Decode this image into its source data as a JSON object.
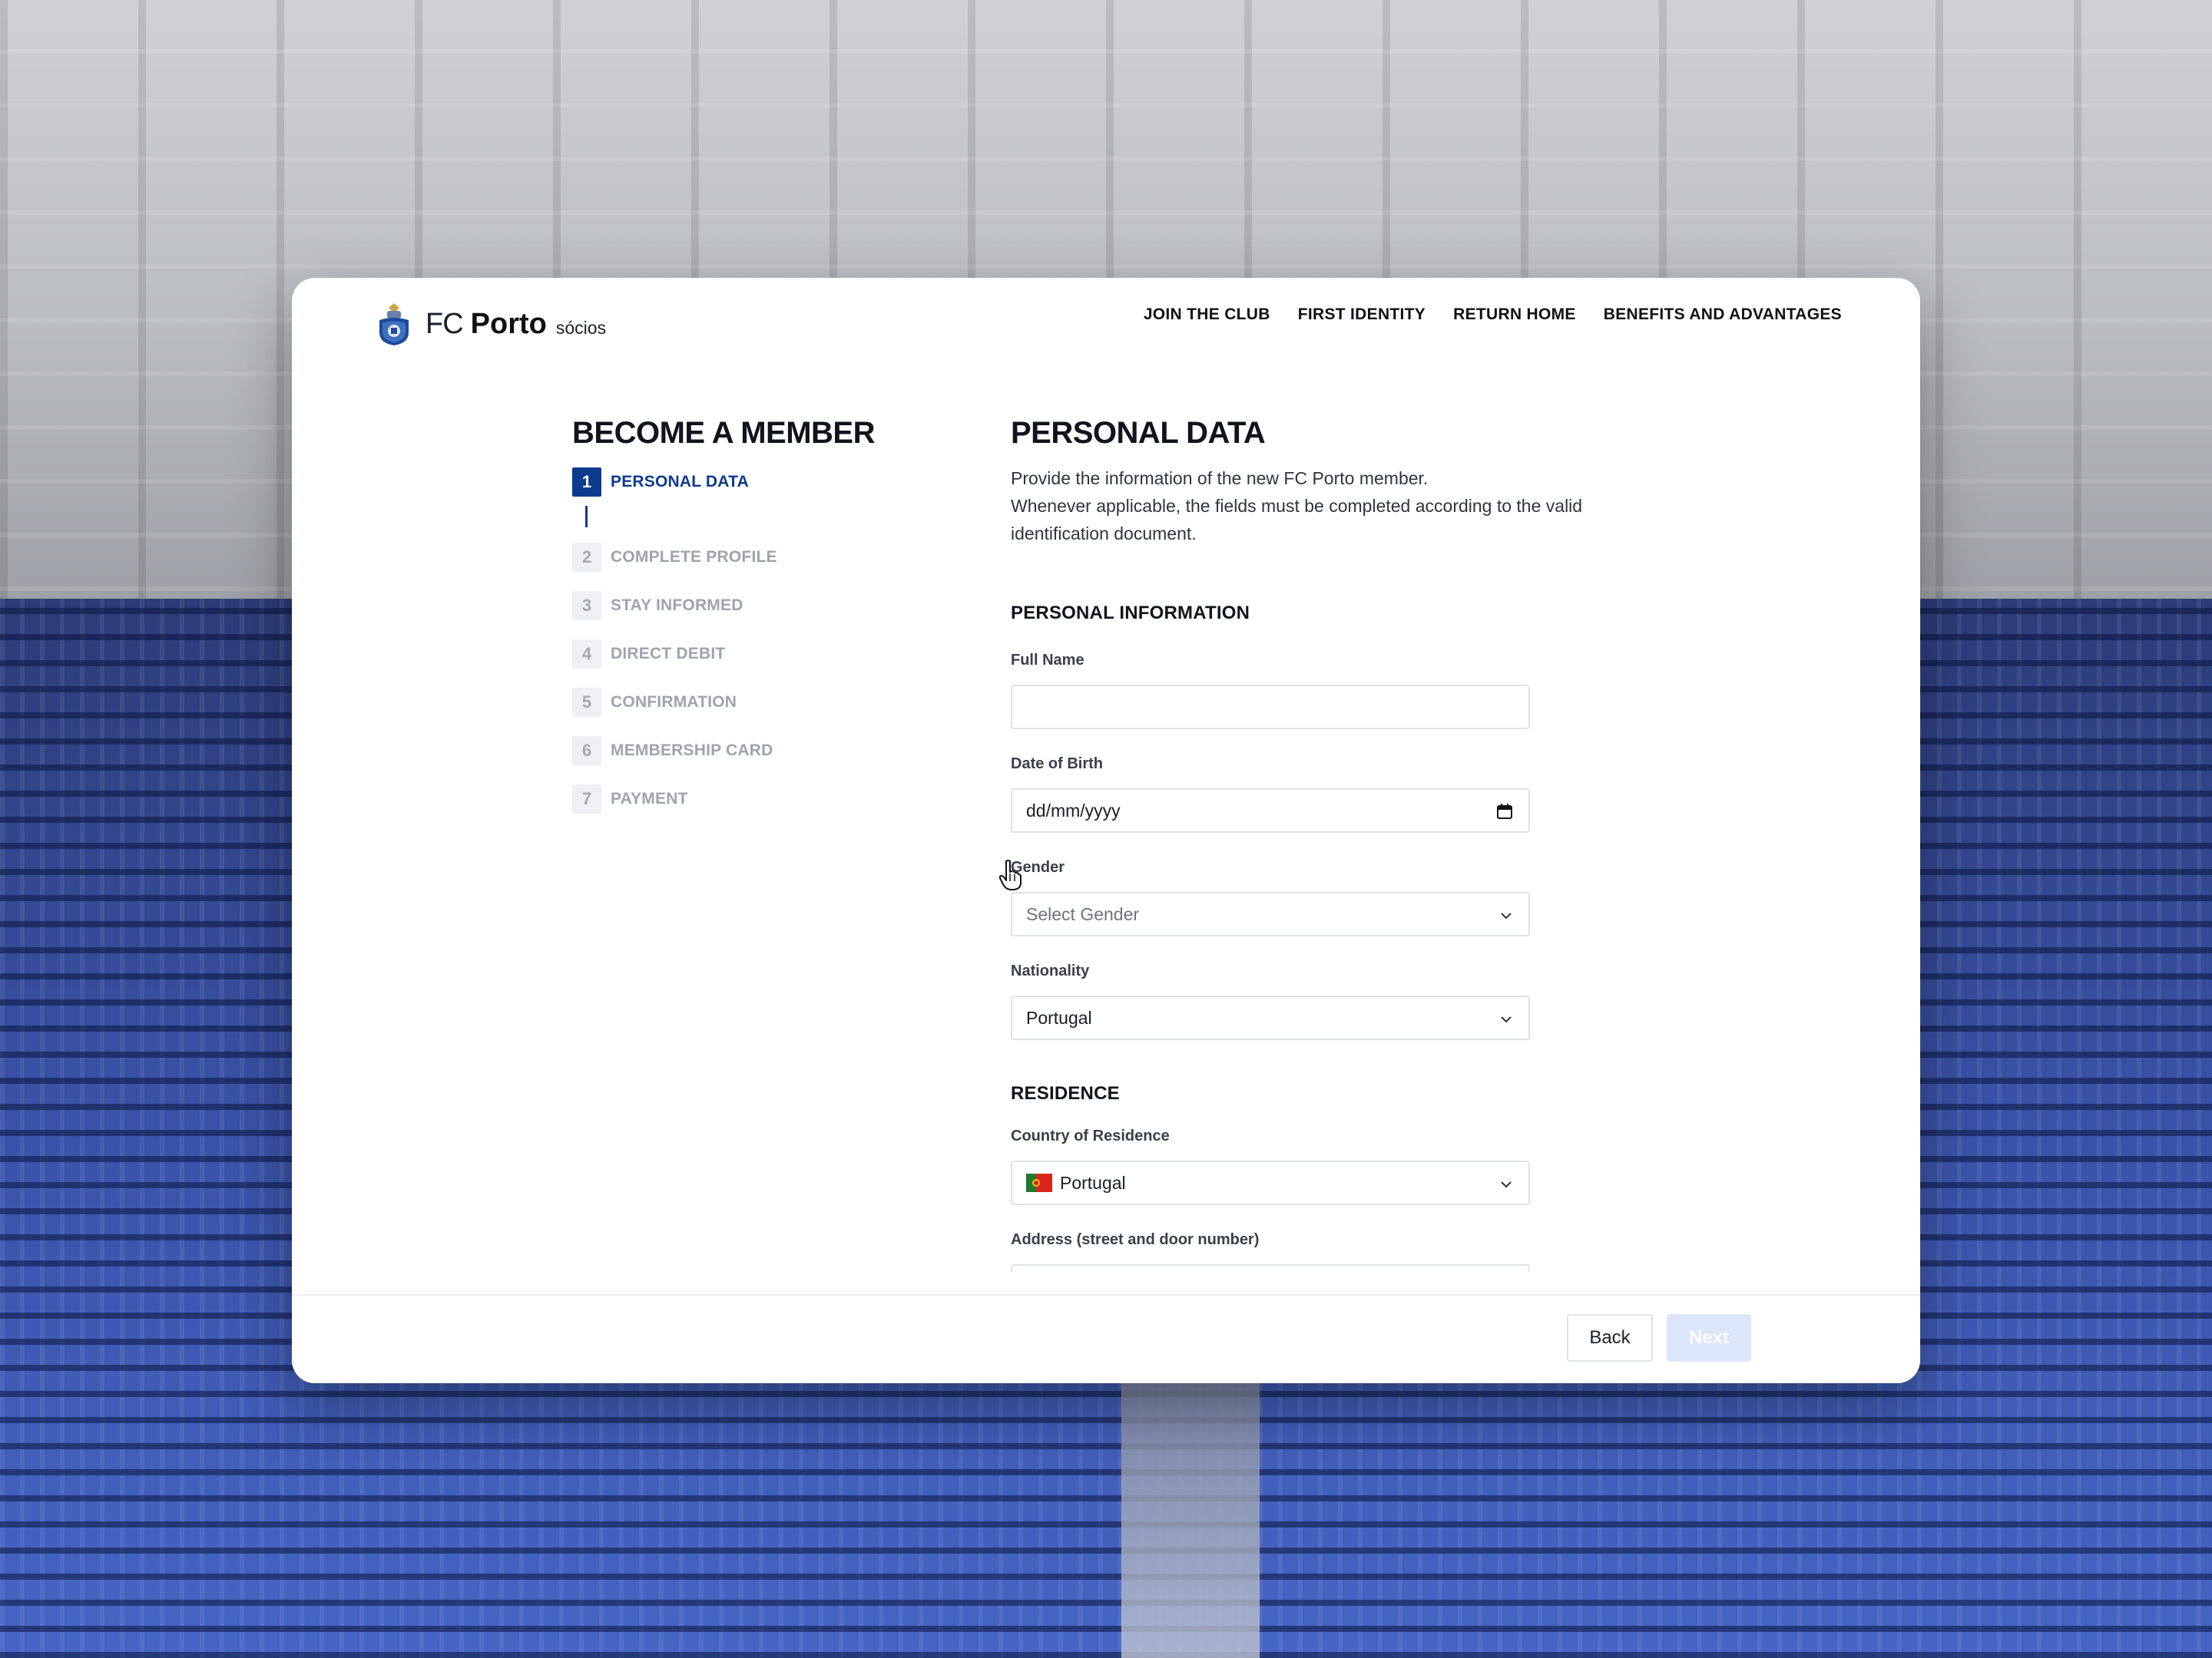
{
  "brand": {
    "fc": "FC",
    "porto": "Porto",
    "socios": "sócios"
  },
  "nav": [
    "JOIN THE CLUB",
    "FIRST IDENTITY",
    "RETURN HOME",
    "BENEFITS AND ADVANTAGES"
  ],
  "stepper": {
    "title": "BECOME A MEMBER",
    "steps": [
      {
        "num": "1",
        "label": "PERSONAL DATA",
        "active": true
      },
      {
        "num": "2",
        "label": "COMPLETE PROFILE",
        "active": false
      },
      {
        "num": "3",
        "label": "STAY INFORMED",
        "active": false
      },
      {
        "num": "4",
        "label": "DIRECT DEBIT",
        "active": false
      },
      {
        "num": "5",
        "label": "CONFIRMATION",
        "active": false
      },
      {
        "num": "6",
        "label": "MEMBERSHIP CARD",
        "active": false
      },
      {
        "num": "7",
        "label": "PAYMENT",
        "active": false
      }
    ]
  },
  "form": {
    "title": "PERSONAL DATA",
    "intro_line1": "Provide the information of the new FC Porto member.",
    "intro_line2": "Whenever applicable, the fields must be completed according to the valid identification document.",
    "section_personal": "PERSONAL INFORMATION",
    "full_name": {
      "label": "Full Name",
      "value": ""
    },
    "dob": {
      "label": "Date of Birth",
      "placeholder": "dd/mm/yyyy"
    },
    "gender": {
      "label": "Gender",
      "placeholder": "Select Gender"
    },
    "nationality": {
      "label": "Nationality",
      "value": "Portugal"
    },
    "section_residence": "RESIDENCE",
    "country": {
      "label": "Country of Residence",
      "value": "Portugal"
    },
    "address": {
      "label": "Address (street and door number)",
      "value": ""
    }
  },
  "footer": {
    "back": "Back",
    "next": "Next"
  },
  "colors": {
    "accent": "#0c3b8e",
    "next_disabled": "#dbe6fb"
  }
}
